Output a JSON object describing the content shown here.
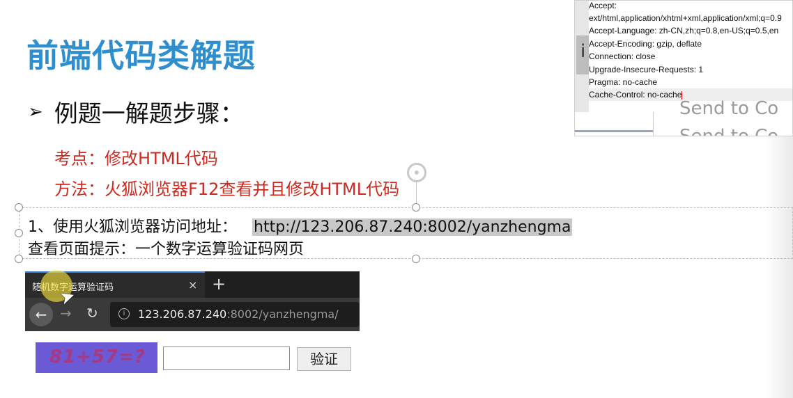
{
  "slide": {
    "title": "前端代码类解题",
    "bullet_marker": "➢",
    "bullet_text": "例题一解题步骤：",
    "focus_line": "考点：修改HTML代码",
    "method_line": "方法：火狐浏览器F12查看并且修改HTML代码",
    "step1_text": "1、使用火狐浏览器访问地址：",
    "step1_url": "http://123.206.87.240:8002/yanzhengma",
    "step2_text": "查看页面提示：一个数字运算验证码网页"
  },
  "browser": {
    "tab_title": "随机数字运算验证码",
    "tab_close": "×",
    "new_tab": "+",
    "back_icon": "←",
    "forward_icon": "→",
    "reload_icon": "↻",
    "info_icon": "i",
    "url_host": "123.206.87.240",
    "url_rest": ":8002/yanzhengma/"
  },
  "form": {
    "captcha_text": "81+57=?",
    "answer_value": "",
    "verify_label": "验证"
  },
  "devtools": {
    "left_char": "i",
    "lines": [
      "Accept:",
      "ext/html,application/xhtml+xml,application/xml;q=0.9",
      "Accept-Language: zh-CN,zh;q=0.8,en-US;q=0.5,en",
      "Accept-Encoding: gzip, deflate",
      "Connection: close",
      "Upgrade-Insecure-Requests: 1",
      "Pragma: no-cache",
      "Cache-Control: no-cache"
    ],
    "ghost_1": "Send to Co",
    "ghost_2": "Send to Co"
  },
  "colors": {
    "title": "#2f8fce",
    "red_text": "#cc2a1e",
    "captcha_bg": "#6a5ad6",
    "captcha_fg": "#a43a86",
    "tab_accent": "#3a7fd5"
  }
}
